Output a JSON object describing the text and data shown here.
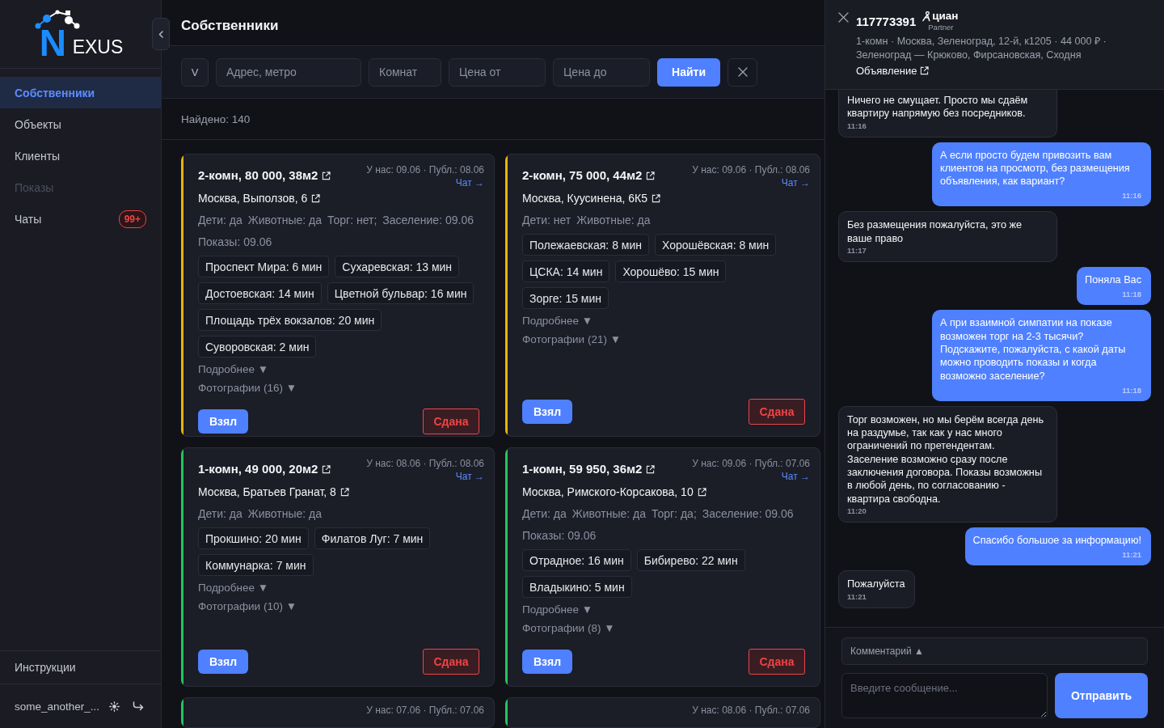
{
  "sidebar": {
    "logo": {
      "initial": "N",
      "rest": "EXUS"
    },
    "nav": [
      {
        "label": "Собственники",
        "selected": true,
        "disabled": false
      },
      {
        "label": "Объекты",
        "selected": false,
        "disabled": false
      },
      {
        "label": "Клиенты",
        "selected": false,
        "disabled": false
      },
      {
        "label": "Показы",
        "selected": false,
        "disabled": true
      },
      {
        "label": "Чаты",
        "selected": false,
        "disabled": false,
        "badge": "99+"
      }
    ],
    "instructions": "Инструкции",
    "user": {
      "name": "some_another_..."
    }
  },
  "page": {
    "title": "Собственники"
  },
  "filters": {
    "toggle": "V",
    "fields": [
      {
        "placeholder": "Адрес, метро"
      },
      {
        "placeholder": "Комнат"
      },
      {
        "placeholder": "Цена от"
      },
      {
        "placeholder": "Цена до"
      }
    ],
    "search_button": "Найти"
  },
  "results": {
    "count": "Найдено: 140"
  },
  "listings": [
    {
      "color": "#eab308",
      "title": "2-комн, 80 000, 38м2",
      "dates": "У нас: 09.06 · Публ.: 08.06",
      "chat_link": "Чат →",
      "address": "Москва, Выползов, 6",
      "details": [
        "Дети: да",
        "Животные: да",
        "Торг: нет;",
        "Заселение: 09.06"
      ],
      "showings": "Показы: 09.06",
      "metro": [
        "Проспект Мира: 6 мин",
        "Сухаревская: 13 мин",
        "Достоевская: 14 мин",
        "Цветной бульвар: 16 мин",
        "Площадь трёх вокзалов: 20 мин",
        "Суворовская: 2 мин"
      ],
      "more": "Подробнее ▼",
      "photos": "Фотографии (16) ▼",
      "take_button": "Взял",
      "rented_button": "Сдана"
    },
    {
      "color": "#eab308",
      "title": "2-комн, 75 000, 44м2",
      "dates": "У нас: 09.06 · Публ.: 08.06",
      "chat_link": "Чат →",
      "address": "Москва, Куусинена, 6К5",
      "details": [
        "Дети: нет",
        "Животные: да"
      ],
      "metro": [
        "Полежаевская: 8 мин",
        "Хорошёвская: 8 мин",
        "ЦСКА: 14 мин",
        "Хорошёво: 15 мин",
        "Зорге: 15 мин"
      ],
      "more": "Подробнее ▼",
      "photos": "Фотографии (21) ▼",
      "take_button": "Взял",
      "rented_button": "Сдана"
    },
    {
      "color": "#22c55e",
      "title": "1-комн, 49 000, 20м2",
      "dates": "У нас: 08.06 · Публ.: 08.06",
      "chat_link": "Чат →",
      "address": "Москва, Братьев Гранат, 8",
      "details": [
        "Дети: да",
        "Животные: да"
      ],
      "metro": [
        "Прокшино: 20 мин",
        "Филатов Луг: 7 мин",
        "Коммунарка: 7 мин"
      ],
      "more": "Подробнее ▼",
      "photos": "Фотографии (10) ▼",
      "take_button": "Взял",
      "rented_button": "Сдана"
    },
    {
      "color": "#22c55e",
      "title": "1-комн, 59 950, 36м2",
      "dates": "У нас: 09.06 · Публ.: 07.06",
      "chat_link": "Чат →",
      "address": "Москва, Римского-Корсакова, 10",
      "details": [
        "Дети: да",
        "Животные: да",
        "Торг: да;",
        "Заселение: 09.06"
      ],
      "showings": "Показы: 09.06",
      "metro": [
        "Отрадное: 16 мин",
        "Бибирево: 22 мин",
        "Владыкино: 5 мин"
      ],
      "more": "Подробнее ▼",
      "photos": "Фотографии (8) ▼",
      "take_button": "Взял",
      "rented_button": "Сдана"
    },
    {
      "color": "#22c55e",
      "dates": "У нас: 07.06 · Публ.: 07.06"
    },
    {
      "color": "#22c55e",
      "dates": "У нас: 08.06 · Публ.: 07.06"
    }
  ],
  "chat": {
    "title": "117773391",
    "source": {
      "name": "циан",
      "tag": "Partner"
    },
    "summary": "1-комн · Москва, Зеленоград, 12-й, к1205 · 44 000 ₽ · Зеленоград — Крюково, Фирсановская, Сходня",
    "listing_link": "Объявление",
    "messages": [
      {
        "kind": "incoming",
        "text": "Ничего не смущает. Просто мы сдаём квартиру напрямую без посредников.",
        "time": "11:16"
      },
      {
        "kind": "outgoing",
        "text": "А если просто будем привозить вам клиентов на просмотр, без размещения объявления, как вариант?",
        "time": "11:16"
      },
      {
        "kind": "incoming",
        "text": "Без размещения пожалуйста, это же ваше право",
        "time": "11:17"
      },
      {
        "kind": "outgoing",
        "text": "Поняла Вас",
        "time": "11:18"
      },
      {
        "kind": "outgoing",
        "text": "А при взаимной симпатии на показе возможен торг на 2-3 тысячи? Подскажите, пожалуйста, с какой даты можно проводить показы и когда возможно заселение?",
        "time": "11:18"
      },
      {
        "kind": "incoming",
        "text": "Торг возможен, но мы берём всегда день на раздумье, так как у нас много ограничений по претендентам. Заселение возможно сразу после заключения договора. Показы возможны в любой день, по согласованию - квартира свободна.",
        "time": "11:20"
      },
      {
        "kind": "outgoing",
        "text": "Спасибо большое за информацию!",
        "time": "11:21"
      },
      {
        "kind": "incoming",
        "text": "Пожалуйста",
        "time": "11:21"
      }
    ],
    "comment_toggle": "Комментарий ▲",
    "composer": {
      "placeholder": "Введите сообщение..."
    },
    "send_button": "Отправить"
  }
}
